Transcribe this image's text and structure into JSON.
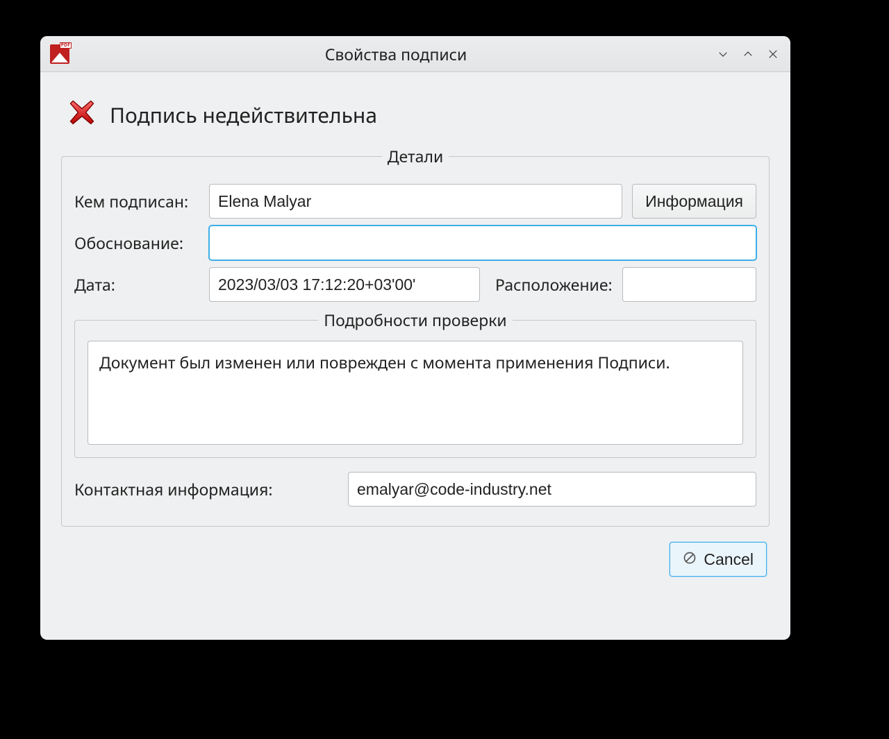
{
  "window": {
    "title": "Свойства подписи",
    "app_icon_tag": "PDF"
  },
  "status": {
    "text": "Подпись недействительна"
  },
  "details_group": {
    "legend": "Детали",
    "signed_by_label": "Кем подписан:",
    "signed_by_value": "Elena Malyar",
    "info_button": "Информация",
    "reason_label": "Обоснование:",
    "reason_value": "",
    "date_label": "Дата:",
    "date_value": "2023/03/03 17:12:20+03'00'",
    "location_label": "Расположение:",
    "location_value": ""
  },
  "verification_group": {
    "legend": "Подробности проверки",
    "message": "Документ был изменен или поврежден с момента применения Подписи."
  },
  "contact": {
    "label": "Контактная информация:",
    "value": "emalyar@code-industry.net"
  },
  "actions": {
    "cancel": "Cancel"
  }
}
